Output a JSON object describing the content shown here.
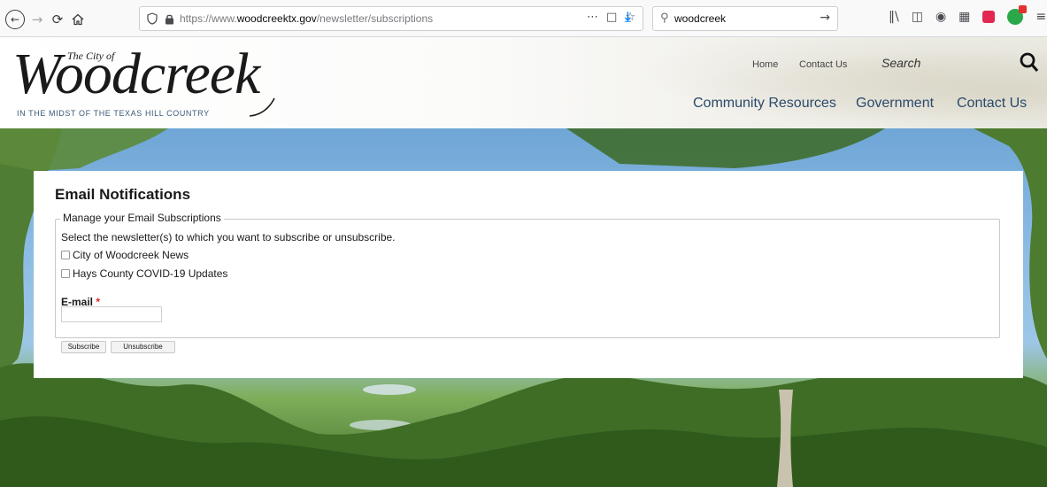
{
  "browser": {
    "url_prefix": "https://www.",
    "url_domain": "woodcreektx.gov",
    "url_path": "/newsletter/subscriptions",
    "search_value": "woodcreek",
    "page_actions_icon": "more-icon",
    "pocket_icon": "pocket-icon",
    "bookmark_icon": "star-icon"
  },
  "site": {
    "logo_small": "The City of",
    "logo_main": "Woodcreek",
    "tagline": "IN THE MIDST OF THE TEXAS HILL COUNTRY",
    "util_links": {
      "home": "Home",
      "contact": "Contact Us"
    },
    "search_placeholder": "Search",
    "nav": {
      "community": "Community Resources",
      "government": "Government",
      "contact": "Contact Us"
    }
  },
  "form": {
    "title": "Email Notifications",
    "legend": "Manage your Email Subscriptions",
    "help": "Select the newsletter(s) to which you want to subscribe or unsubscribe.",
    "options": [
      {
        "label": "City of Woodcreek News",
        "checked": false
      },
      {
        "label": "Hays County COVID-19 Updates",
        "checked": false
      }
    ],
    "email_label": "E-mail",
    "required_mark": "*",
    "email_value": "",
    "subscribe_label": "Subscribe",
    "unsubscribe_label": "Unsubscribe"
  },
  "colors": {
    "nav_text": "#2b4a6b",
    "required": "#e0252b",
    "download_blue": "#0a84ff"
  }
}
